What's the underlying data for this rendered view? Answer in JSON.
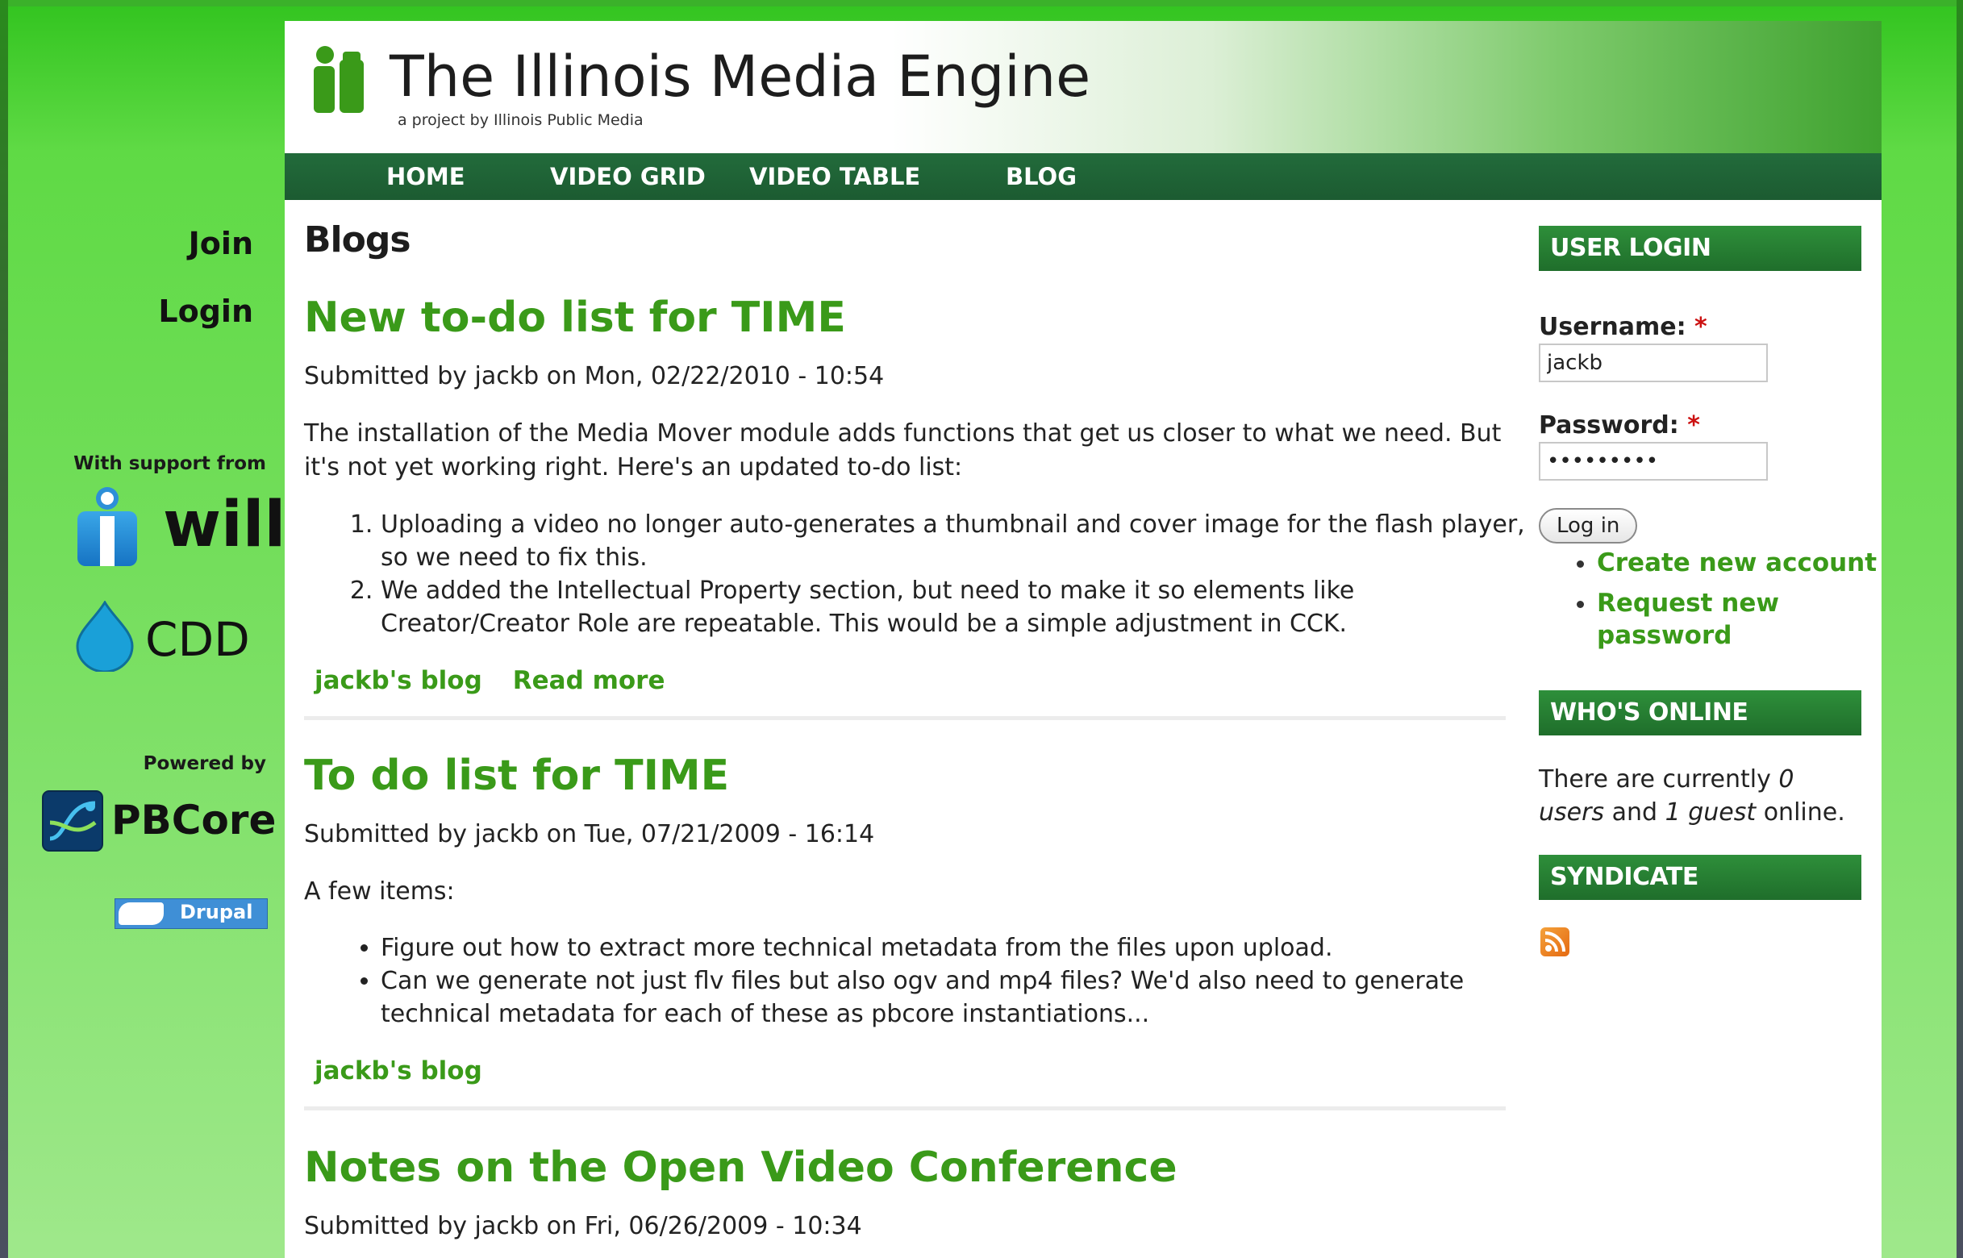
{
  "site": {
    "title": "The Illinois Media Engine",
    "tagline": "a project by Illinois Public Media"
  },
  "nav": [
    "HOME",
    "VIDEO GRID",
    "VIDEO TABLE",
    "BLOG"
  ],
  "left_sidebar": {
    "join": "Join",
    "login": "Login",
    "support_label": "With support from",
    "will_text": "will",
    "cdd_text": "CDD",
    "powered_by_label": "Powered by",
    "pbcore_text": "PBCore",
    "drupal_text": "Drupal"
  },
  "main": {
    "heading": "Blogs",
    "posts": [
      {
        "title": "New to-do list for TIME",
        "meta": "Submitted by jackb on Mon, 02/22/2010 - 10:54",
        "body": "The installation of the Media Mover module adds functions that get us closer to what we need. But it's not yet working right. Here's an updated to-do list:",
        "items": [
          "Uploading a video no longer auto-generates a thumbnail and cover image for the flash player, so we need to fix this.",
          "We added the Intellectual Property section, but need to make it so elements like Creator/Creator Role are repeatable. This would be a simple adjustment in CCK."
        ],
        "blog_link": "jackb's blog",
        "read_more": "Read more"
      },
      {
        "title": "To do list for TIME",
        "meta": "Submitted by jackb on Tue, 07/21/2009 - 16:14",
        "body": "A few items:",
        "items": [
          "Figure out how to extract more technical metadata from the files upon upload.",
          "Can we generate not just flv files but also ogv and mp4 files? We'd also need to generate technical metadata for each of these as pbcore instantiations..."
        ],
        "blog_link": "jackb's blog"
      },
      {
        "title": "Notes on the Open Video Conference",
        "meta": "Submitted by jackb on Fri, 06/26/2009 - 10:34"
      }
    ]
  },
  "right_sidebar": {
    "login_title": "USER LOGIN",
    "username_label": "Username:",
    "required_mark": "*",
    "username_value": "jackb",
    "password_label": "Password:",
    "password_value": "•••••••••",
    "login_button": "Log in",
    "links": [
      "Create new account",
      "Request new password"
    ],
    "online_title": "WHO'S ONLINE",
    "online_prefix": "There are currently",
    "online_users_count": "0 users",
    "online_and": "and",
    "online_guest_count": "1 guest",
    "online_suffix": "online.",
    "syndicate_title": "SYNDICATE",
    "rss_icon": "rss-feed-icon"
  },
  "colors": {
    "accent_green": "#3a9a19",
    "nav_green": "#1c5b31",
    "background_green": "#74de5c"
  }
}
